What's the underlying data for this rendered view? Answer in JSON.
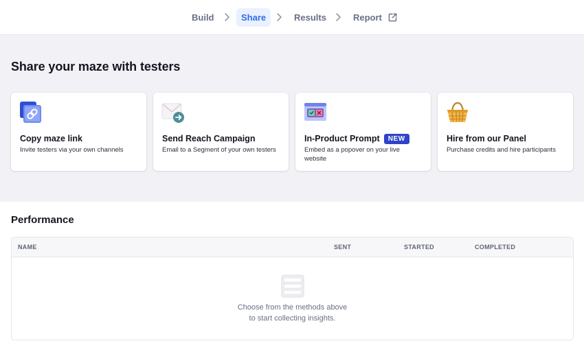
{
  "nav": {
    "steps": [
      "Build",
      "Share",
      "Results",
      "Report"
    ],
    "active": "Share"
  },
  "share": {
    "title": "Share your maze with testers",
    "cards": [
      {
        "title": "Copy maze link",
        "desc": "Invite testers via your own channels",
        "icon": "link-icon"
      },
      {
        "title": "Send Reach Campaign",
        "desc": "Email to a Segment of your own testers",
        "icon": "mail-send-icon"
      },
      {
        "title": "In-Product Prompt",
        "badge": "NEW",
        "desc": "Embed as a popover on your live website",
        "icon": "popover-prompt-icon"
      },
      {
        "title": "Hire from our Panel",
        "desc": "Purchase credits and hire participants",
        "icon": "basket-icon"
      }
    ]
  },
  "performance": {
    "title": "Performance",
    "columns": [
      "NAME",
      "SENT",
      "STARTED",
      "COMPLETED"
    ],
    "rows": [],
    "empty_line1": "Choose from the methods above",
    "empty_line2": "to start collecting insights."
  },
  "colors": {
    "accent": "#2f6bf2",
    "badge": "#2f42c9",
    "section_bg": "#f2f2f6"
  }
}
